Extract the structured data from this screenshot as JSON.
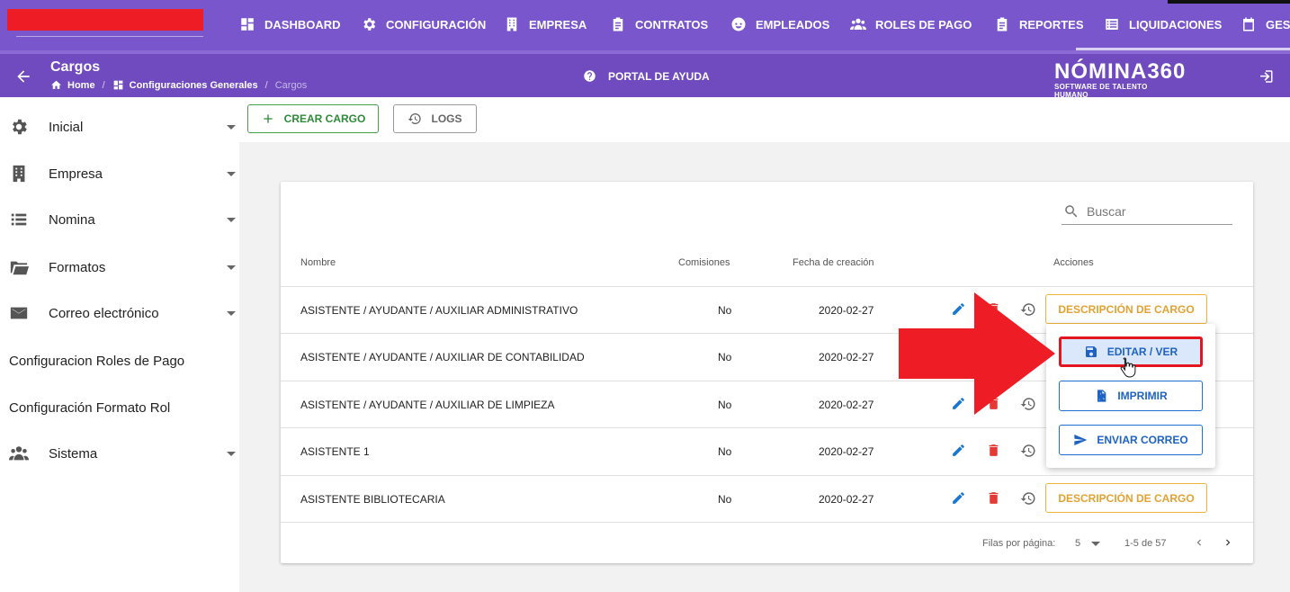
{
  "topnav": {
    "items": [
      {
        "label": "DASHBOARD",
        "icon": "dashboard-icon"
      },
      {
        "label": "CONFIGURACIÓN",
        "icon": "gear-icon"
      },
      {
        "label": "EMPRESA",
        "icon": "building-icon"
      },
      {
        "label": "CONTRATOS",
        "icon": "clipboard-icon"
      },
      {
        "label": "EMPLEADOS",
        "icon": "face-icon"
      },
      {
        "label": "ROLES DE PAGO",
        "icon": "users-icon"
      },
      {
        "label": "REPORTES",
        "icon": "clipboard-icon"
      },
      {
        "label": "LIQUIDACIONES",
        "icon": "list-icon"
      },
      {
        "label": "GES",
        "icon": "calendar-icon"
      }
    ]
  },
  "header": {
    "title": "Cargos",
    "breadcrumb": {
      "home": "Home",
      "section": "Configuraciones Generales",
      "current": "Cargos",
      "sep": "/"
    },
    "portal": "PORTAL DE AYUDA",
    "logo_main": "NÓMINA360",
    "logo_sub": "SOFTWARE DE TALENTO HUMANO"
  },
  "sidebar": {
    "items": [
      {
        "label": "Inicial",
        "icon": "gear-icon",
        "expandable": true
      },
      {
        "label": "Empresa",
        "icon": "building-icon",
        "expandable": true
      },
      {
        "label": "Nomina",
        "icon": "list-icon",
        "expandable": true
      },
      {
        "label": "Formatos",
        "icon": "folder-icon",
        "expandable": true
      },
      {
        "label": "Correo electrónico",
        "icon": "mail-icon",
        "expandable": true
      },
      {
        "label": "Configuracion Roles de Pago",
        "icon": "",
        "expandable": false
      },
      {
        "label": "Configuración Formato Rol",
        "icon": "",
        "expandable": false
      },
      {
        "label": "Sistema",
        "icon": "users-icon",
        "expandable": true
      }
    ]
  },
  "toolbar": {
    "crear_label": "CREAR CARGO",
    "logs_label": "LOGS"
  },
  "search": {
    "placeholder": "Buscar"
  },
  "table": {
    "headers": {
      "name": "Nombre",
      "comisiones": "Comisiones",
      "fecha": "Fecha de creación",
      "acciones": "Acciones"
    },
    "desc_label": "DESCRIPCIÓN DE CARGO",
    "rows": [
      {
        "name": "ASISTENTE / AYUDANTE / AUXILIAR ADMINISTRATIVO",
        "comisiones": "No",
        "fecha": "2020-02-27"
      },
      {
        "name": "ASISTENTE / AYUDANTE / AUXILIAR DE CONTABILIDAD",
        "comisiones": "No",
        "fecha": "2020-02-27"
      },
      {
        "name": "ASISTENTE / AYUDANTE / AUXILIAR DE LIMPIEZA",
        "comisiones": "No",
        "fecha": "2020-02-27"
      },
      {
        "name": "ASISTENTE 1",
        "comisiones": "No",
        "fecha": "2020-02-27"
      },
      {
        "name": "ASISTENTE BIBLIOTECARIA",
        "comisiones": "No",
        "fecha": "2020-02-27"
      }
    ]
  },
  "pagination": {
    "rows_per_page_label": "Filas por página:",
    "rows_per_page": "5",
    "range": "1-5 de 57"
  },
  "menu": {
    "edit_label": "EDITAR / VER",
    "print_label": "IMPRIMIR",
    "email_label": "ENVIAR CORREO"
  },
  "colors": {
    "primary": "#7a56cc",
    "header": "#6f4bbf",
    "accent_red": "#ee1c25",
    "success": "#43a047",
    "warning": "#f0b43a",
    "info": "#1e6fd0"
  }
}
